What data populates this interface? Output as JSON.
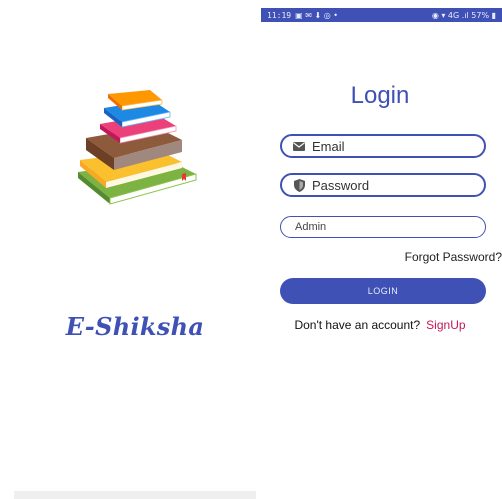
{
  "splash": {
    "brand": "E-Shiksha",
    "logo_icon": "books-stack-icon"
  },
  "status_bar": {
    "time": "11:19",
    "left_icons": "▣ ✉ ⬇ ◎ •",
    "right_text": "◉ ▾ 4G .ıl 57% ▮"
  },
  "login": {
    "title": "Login",
    "email_placeholder": "Email",
    "password_placeholder": "Password",
    "role_value": "Admin",
    "forgot_label": "Forgot Password?",
    "button_label": "LOGIN",
    "no_account_text": "Don't have an account?",
    "signup_label": "SignUp"
  },
  "colors": {
    "primary": "#3f51b5",
    "accent": "#c2185b"
  }
}
